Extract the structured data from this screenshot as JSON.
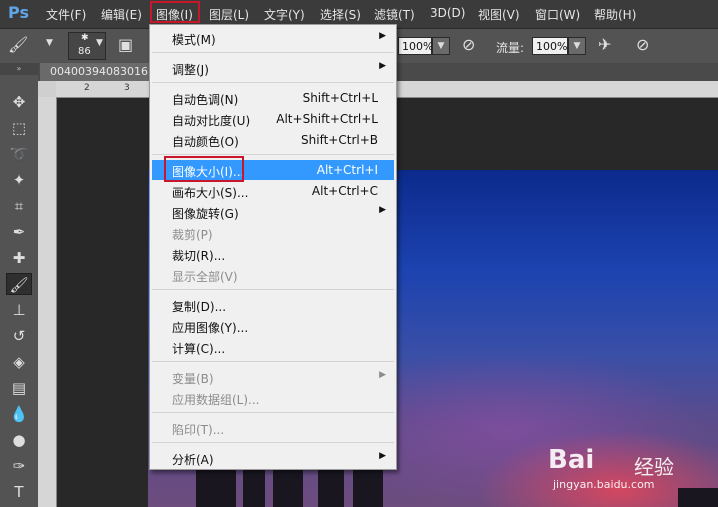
{
  "app": {
    "logo": "Ps"
  },
  "menubar": {
    "items": [
      {
        "label": "文件(F)"
      },
      {
        "label": "编辑(E)"
      },
      {
        "label": "图像(I)"
      },
      {
        "label": "图层(L)"
      },
      {
        "label": "文字(Y)"
      },
      {
        "label": "选择(S)"
      },
      {
        "label": "滤镜(T)"
      },
      {
        "label": "3D(D)"
      },
      {
        "label": "视图(V)"
      },
      {
        "label": "窗口(W)"
      },
      {
        "label": "帮助(H)"
      }
    ],
    "active_item": "图像(I)"
  },
  "options_bar": {
    "brush_size": "86",
    "opacity_value": "100%",
    "flow_label": "流量:",
    "flow_value": "100%"
  },
  "document": {
    "tab_title": "00400394083016",
    "ruler_ticks": [
      "2",
      "3"
    ]
  },
  "image_menu": {
    "items": [
      {
        "label": "模式(M)",
        "submenu": true
      },
      {
        "label": "调整(J)",
        "submenu": true
      },
      {
        "label": "自动色调(N)",
        "shortcut": "Shift+Ctrl+L"
      },
      {
        "label": "自动对比度(U)",
        "shortcut": "Alt+Shift+Ctrl+L"
      },
      {
        "label": "自动颜色(O)",
        "shortcut": "Shift+Ctrl+B"
      },
      {
        "label": "图像大小(I)...",
        "shortcut": "Alt+Ctrl+I",
        "highlighted": true
      },
      {
        "label": "画布大小(S)...",
        "shortcut": "Alt+Ctrl+C"
      },
      {
        "label": "图像旋转(G)",
        "submenu": true
      },
      {
        "label": "裁剪(P)",
        "disabled": true
      },
      {
        "label": "裁切(R)..."
      },
      {
        "label": "显示全部(V)",
        "disabled": true
      },
      {
        "label": "复制(D)..."
      },
      {
        "label": "应用图像(Y)..."
      },
      {
        "label": "计算(C)..."
      },
      {
        "label": "变量(B)",
        "submenu": true,
        "disabled": true
      },
      {
        "label": "应用数据组(L)...",
        "disabled": true
      },
      {
        "label": "陷印(T)...",
        "disabled": true
      },
      {
        "label": "分析(A)",
        "submenu": true
      }
    ],
    "submenu_arrow": "▶"
  },
  "watermark": {
    "logo": "Bai",
    "brand": "经验",
    "url": "jingyan.baidu.com"
  },
  "colors": {
    "highlight": "#3399ff",
    "annotation_red": "#c8172a"
  }
}
